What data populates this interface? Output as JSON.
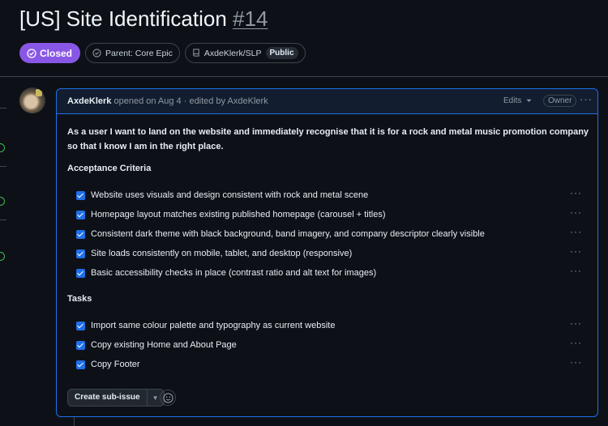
{
  "issue": {
    "title": "[US] Site Identification",
    "number": "#14",
    "status": "Closed",
    "parent": "Parent: Core Epic",
    "repo": "AxdeKlerk/SLP",
    "visibility": "Public"
  },
  "comment": {
    "author": "AxdeKlerk",
    "meta": " opened on Aug 4 · edited by AxdeKlerk",
    "edits_label": "Edits",
    "owner_label": "Owner",
    "body": "As a user I want to land on the website and immediately recognise that it is for a rock and metal music promotion company so that I know I am in the right place.",
    "acceptance_heading": "Acceptance Criteria",
    "acceptance": [
      "Website uses visuals and design consistent with rock and metal scene",
      "Homepage layout matches existing published homepage (carousel + titles)",
      "Consistent dark theme with black background, band imagery, and company descriptor clearly visible",
      "Site loads consistently on mobile, tablet, and desktop (responsive)",
      "Basic accessibility checks in place (contrast ratio and alt text for images)"
    ],
    "tasks_heading": "Tasks",
    "tasks": [
      "Import same colour palette and typography as current website",
      "Copy existing Home and About Page",
      "Copy Footer"
    ],
    "create_subissue_label": "Create sub-issue"
  },
  "colors": {
    "closed": "#8957e5",
    "accent": "#1f6feb",
    "background": "#0d1117"
  },
  "icons": [
    "check-circle-icon",
    "issue-circle-icon",
    "repo-icon",
    "kebab-icon",
    "chevron-down-icon",
    "smiley-icon"
  ]
}
